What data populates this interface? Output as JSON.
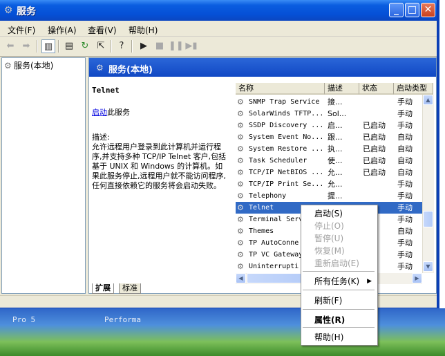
{
  "window": {
    "title": "服务"
  },
  "desktop": {
    "items": [
      "Pro 5",
      "Performa"
    ]
  },
  "menubar": {
    "items": [
      "文件(F)",
      "操作(A)",
      "查看(V)",
      "帮助(H)"
    ]
  },
  "tree": {
    "root_label": "服务(本地)"
  },
  "panel": {
    "header": "服务(本地)",
    "service_name": "Telnet",
    "action_link": "启动",
    "action_suffix": "此服务",
    "desc_label": "描述:",
    "description": "允许远程用户登录到此计算机并运行程序,并支持多种 TCP/IP Telnet 客户,包括基于 UNIX 和 Windows 的计算机。如果此服务停止,远程用户就不能访问程序,任何直接依赖它的服务将会启动失败。"
  },
  "list": {
    "columns": [
      "名称",
      "描述",
      "状态",
      "启动类型"
    ],
    "rows": [
      {
        "name": "SNMP Trap Service",
        "desc": "接...",
        "status": "",
        "startup": "手动"
      },
      {
        "name": "SolarWinds TFTP...",
        "desc": "Sol...",
        "status": "",
        "startup": "手动"
      },
      {
        "name": "SSDP Discovery ...",
        "desc": "启...",
        "status": "已启动",
        "startup": "手动"
      },
      {
        "name": "System Event No...",
        "desc": "跟...",
        "status": "已启动",
        "startup": "自动"
      },
      {
        "name": "System Restore ...",
        "desc": "执...",
        "status": "已启动",
        "startup": "自动"
      },
      {
        "name": "Task Scheduler",
        "desc": "使...",
        "status": "已启动",
        "startup": "自动"
      },
      {
        "name": "TCP/IP NetBIOS ...",
        "desc": "允...",
        "status": "已启动",
        "startup": "自动"
      },
      {
        "name": "TCP/IP Print Se...",
        "desc": "允...",
        "status": "",
        "startup": "手动"
      },
      {
        "name": "Telephony",
        "desc": "提...",
        "status": "",
        "startup": "手动"
      },
      {
        "name": "Telnet",
        "desc": "",
        "status": "",
        "startup": "手动"
      },
      {
        "name": "Terminal Serv",
        "desc": "",
        "status": "启动",
        "startup": "手动"
      },
      {
        "name": "Themes",
        "desc": "",
        "status": "启动",
        "startup": "自动"
      },
      {
        "name": "TP AutoConne",
        "desc": "",
        "status": "",
        "startup": "手动"
      },
      {
        "name": "TP VC Gateway",
        "desc": "",
        "status": "",
        "startup": "手动"
      },
      {
        "name": "Uninterrupti",
        "desc": "",
        "status": "",
        "startup": "手动"
      }
    ]
  },
  "tabs": [
    "扩展",
    "标准"
  ],
  "context_menu": {
    "items": [
      {
        "label": "启动(S)",
        "enabled": true
      },
      {
        "label": "停止(O)",
        "enabled": false
      },
      {
        "label": "暂停(U)",
        "enabled": false
      },
      {
        "label": "恢复(M)",
        "enabled": false
      },
      {
        "label": "重新启动(E)",
        "enabled": false
      },
      {
        "label": "所有任务(K)",
        "enabled": true,
        "submenu": true
      },
      {
        "label": "刷新(F)",
        "enabled": true
      },
      {
        "label": "属性(R)",
        "enabled": true,
        "bold": true
      },
      {
        "label": "帮助(H)",
        "enabled": true
      }
    ]
  },
  "colors": {
    "titlebar": "#0550d6",
    "selection": "#316ac5",
    "window_bg": "#ece9d8"
  }
}
